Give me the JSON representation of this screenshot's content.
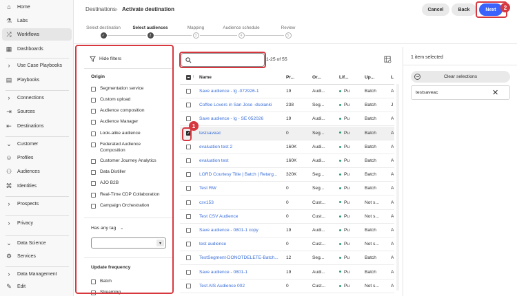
{
  "nav": {
    "items": [
      {
        "label": "Home",
        "icon": "home-icon"
      },
      {
        "label": "Labs",
        "icon": "labs-icon"
      },
      {
        "label": "Workflows",
        "icon": "workflows-icon"
      },
      {
        "label": "Dashboards",
        "icon": "dashboards-icon"
      },
      {
        "label": "Use Case Playbooks",
        "icon": "chevron-right-icon"
      },
      {
        "label": "Playbooks",
        "icon": "playbooks-icon"
      },
      {
        "label": "Connections",
        "icon": "chevron-right-icon"
      },
      {
        "label": "Sources",
        "icon": "sources-icon"
      },
      {
        "label": "Destinations",
        "icon": "destinations-icon"
      },
      {
        "label": "Customer",
        "icon": "chevron-down-icon"
      },
      {
        "label": "Profiles",
        "icon": "profiles-icon"
      },
      {
        "label": "Audiences",
        "icon": "audiences-icon"
      },
      {
        "label": "Identities",
        "icon": "identities-icon"
      },
      {
        "label": "Prospects",
        "icon": "chevron-right-icon"
      },
      {
        "label": "Privacy",
        "icon": "chevron-right-icon"
      },
      {
        "label": "Data Science",
        "icon": "chevron-down-icon"
      },
      {
        "label": "Services",
        "icon": "services-icon"
      },
      {
        "label": "Data Management",
        "icon": "chevron-right-icon"
      }
    ],
    "edit_label": "Edit"
  },
  "header": {
    "breadcrumb_root": "Destinations",
    "breadcrumb_sep": "›",
    "title": "Activate destination",
    "cancel_label": "Cancel",
    "back_label": "Back",
    "next_label": "Next"
  },
  "steps": [
    {
      "label": "Select destination",
      "state": "done",
      "marker": "✓"
    },
    {
      "label": "Select audiences",
      "state": "current",
      "marker": "2"
    },
    {
      "label": "Mapping",
      "state": "todo",
      "marker": "3"
    },
    {
      "label": "Audience schedule",
      "state": "todo",
      "marker": "4"
    },
    {
      "label": "Review",
      "state": "todo",
      "marker": "5"
    }
  ],
  "filters": {
    "hide_label": "Hide filters",
    "origin_title": "Origin",
    "origin_items": [
      "Segmentation service",
      "Custom upload",
      "Audience composition",
      "Audience Manager",
      "Look-alike audience",
      "Federated Audience Composition",
      "Customer Journey Analytics",
      "Data Distiller",
      "AJO B2B",
      "Real-Time CDP Collaboration",
      "Campaign Orchestration"
    ],
    "tag_label": "Has any tag",
    "update_title": "Update frequency",
    "update_items": [
      "Batch",
      "Streaming"
    ]
  },
  "table": {
    "search_placeholder": "",
    "count_text": "1-25 of 55",
    "columns": [
      "Name",
      "Pr...",
      "Or...",
      "Lif...",
      "Up...",
      "L"
    ],
    "rows": [
      {
        "name": "Save audience - lg -072926-1",
        "pr": "19",
        "or": "Audi...",
        "lif": "Pu",
        "up": "Batch",
        "l": "A",
        "checked": false
      },
      {
        "name": "Coffee Lovers in San Jose -dsolanki",
        "pr": "238",
        "or": "Seg...",
        "lif": "Pu",
        "up": "Batch",
        "l": "J",
        "checked": false
      },
      {
        "name": "Save audience - lg - SE 052026",
        "pr": "19",
        "or": "Audi...",
        "lif": "Pu",
        "up": "Batch",
        "l": "A",
        "checked": false
      },
      {
        "name": "testsaveac",
        "pr": "0",
        "or": "Seg...",
        "lif": "Pu",
        "up": "Batch",
        "l": "A",
        "checked": true
      },
      {
        "name": "evaluation test 2",
        "pr": "160K",
        "or": "Audi...",
        "lif": "Pu",
        "up": "Batch",
        "l": "A",
        "checked": false
      },
      {
        "name": "evaluation test",
        "pr": "160K",
        "or": "Audi...",
        "lif": "Pu",
        "up": "Batch",
        "l": "A",
        "checked": false
      },
      {
        "name": "LORD Courtesy Title | Batch | Retarg...",
        "pr": "320K",
        "or": "Seg...",
        "lif": "Pu",
        "up": "Batch",
        "l": "A",
        "checked": false
      },
      {
        "name": "Test RW",
        "pr": "0",
        "or": "Seg...",
        "lif": "Pu",
        "up": "Batch",
        "l": "A",
        "checked": false
      },
      {
        "name": "csv153",
        "pr": "0",
        "or": "Cust...",
        "lif": "Pu",
        "up": "Not s...",
        "l": "A",
        "checked": false
      },
      {
        "name": "Test CSV Audience",
        "pr": "0",
        "or": "Cust...",
        "lif": "Pu",
        "up": "Not s...",
        "l": "A",
        "checked": false
      },
      {
        "name": "Save audience - 0801-1 copy",
        "pr": "19",
        "or": "Audi...",
        "lif": "Pu",
        "up": "Batch",
        "l": "A",
        "checked": false
      },
      {
        "name": "test audience",
        "pr": "0",
        "or": "Cust...",
        "lif": "Pu",
        "up": "Not s...",
        "l": "A",
        "checked": false
      },
      {
        "name": "TestSegment-DONOTDELETE-Batch...",
        "pr": "12",
        "or": "Seg...",
        "lif": "Pu",
        "up": "Batch",
        "l": "A",
        "checked": false
      },
      {
        "name": "Save audience - 0801-1",
        "pr": "19",
        "or": "Audi...",
        "lif": "Pu",
        "up": "Batch",
        "l": "A",
        "checked": false
      },
      {
        "name": "Test AIS Audience 002",
        "pr": "0",
        "or": "Cust...",
        "lif": "Pu",
        "up": "Not s...",
        "l": "A",
        "checked": false
      }
    ]
  },
  "selection": {
    "title": "1 item selected",
    "clear_label": "Clear selections",
    "items": [
      "testsaveac"
    ]
  },
  "annotations": {
    "badge1": "1",
    "badge2": "2"
  },
  "colors": {
    "accent": "#3b63fb",
    "highlight": "#d7373f",
    "link": "#3a6fd8",
    "status_green": "#2d9d78"
  }
}
